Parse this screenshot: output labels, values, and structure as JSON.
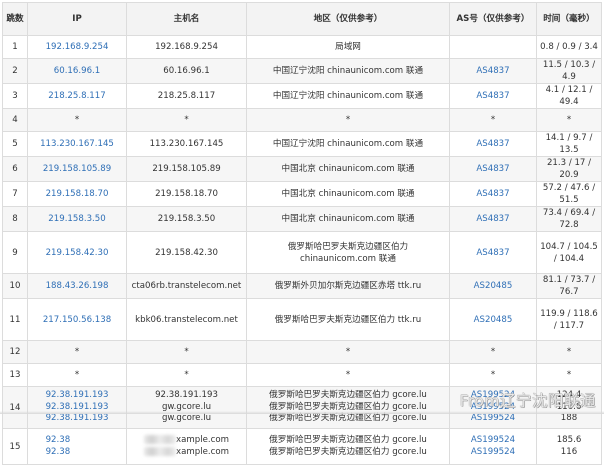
{
  "table": {
    "headers": {
      "hop": "跳数",
      "ip": "IP",
      "host": "主机名",
      "location": "地区（仅供参考）",
      "as": "AS号（仅供参考）",
      "time": "时间（毫秒）"
    },
    "rows": [
      {
        "hop": "1",
        "ip": "192.168.9.254",
        "host": "192.168.9.254",
        "loc": "局域网",
        "as": "",
        "time": "0.8 / 0.9 / 3.4"
      },
      {
        "hop": "2",
        "ip": "60.16.96.1",
        "host": "60.16.96.1",
        "loc": "中国辽宁沈阳 chinaunicom.com 联通",
        "as": "AS4837",
        "time": "11.5 / 10.3 / 4.9"
      },
      {
        "hop": "3",
        "ip": "218.25.8.117",
        "host": "218.25.8.117",
        "loc": "中国辽宁沈阳 chinaunicom.com 联通",
        "as": "AS4837",
        "time": "4.1 / 12.1 / 49.4"
      },
      {
        "hop": "4",
        "ip": "*",
        "host": "*",
        "loc": "*",
        "as": "*",
        "time": "*"
      },
      {
        "hop": "5",
        "ip": "113.230.167.145",
        "host": "113.230.167.145",
        "loc": "中国辽宁沈阳 chinaunicom.com 联通",
        "as": "AS4837",
        "time": "14.1 / 9.7 / 13.5"
      },
      {
        "hop": "6",
        "ip": "219.158.105.89",
        "host": "219.158.105.89",
        "loc": "中国北京 chinaunicom.com 联通",
        "as": "AS4837",
        "time": "21.3 / 17 / 20.9"
      },
      {
        "hop": "7",
        "ip": "219.158.18.70",
        "host": "219.158.18.70",
        "loc": "中国北京 chinaunicom.com 联通",
        "as": "AS4837",
        "time": "57.2 / 47.6 / 51.5"
      },
      {
        "hop": "8",
        "ip": "219.158.3.50",
        "host": "219.158.3.50",
        "loc": "中国北京 chinaunicom.com 联通",
        "as": "AS4837",
        "time": "73.4 / 69.4 / 72.8"
      },
      {
        "hop": "9",
        "ip": "219.158.42.30",
        "host": "219.158.42.30",
        "loc": "俄罗斯哈巴罗夫斯克边疆区伯力 chinaunicom.com 联通",
        "as": "AS4837",
        "time": "104.7 / 104.5 / 104.4"
      },
      {
        "hop": "10",
        "ip": "188.43.26.198",
        "host": "cta06rb.transtelecom.net",
        "loc": "俄罗斯外贝加尔斯克边疆区赤塔 ttk.ru",
        "as": "AS20485",
        "time": "81.1 / 73.7 / 76.7"
      },
      {
        "hop": "11",
        "ip": "217.150.56.138",
        "host": "kbk06.transtelecom.net",
        "loc": "俄罗斯哈巴罗夫斯克边疆区伯力 ttk.ru",
        "as": "AS20485",
        "time": "119.9 / 118.6 / 117.7"
      },
      {
        "hop": "12",
        "ip": "*",
        "host": "*",
        "loc": "*",
        "as": "*",
        "time": "*"
      },
      {
        "hop": "13",
        "ip": "*",
        "host": "*",
        "loc": "*",
        "as": "*",
        "time": "*"
      }
    ],
    "row14": {
      "hop": "14",
      "ips": [
        "92.38.191.193",
        "92.38.191.193",
        "92.38.191.193"
      ],
      "hosts": [
        "92.38.191.193",
        "gw.gcore.lu",
        "gw.gcore.lu"
      ],
      "locs": [
        "俄罗斯哈巴罗夫斯克边疆区伯力 gcore.lu",
        "俄罗斯哈巴罗夫斯克边疆区伯力 gcore.lu",
        "俄罗斯哈巴罗夫斯克边疆区伯力 gcore.lu"
      ],
      "as": [
        "AS199524",
        "AS199524",
        "AS199524"
      ],
      "times": [
        "124.4",
        "116.6",
        "188"
      ]
    },
    "row15": {
      "hop": "15",
      "ips": [
        "92.38",
        "92.38"
      ],
      "hosts": [
        "xample.com",
        "xample.com"
      ],
      "locs": [
        "俄罗斯哈巴罗夫斯克边疆区伯力 gcore.lu",
        "俄罗斯哈巴罗夫斯克边疆区伯力 gcore.lu"
      ],
      "as": [
        "AS199524",
        "AS199524"
      ],
      "times": [
        "185.6",
        "116"
      ]
    }
  },
  "watermark": "From辽宁沈阳联通",
  "colors": {
    "link": "#2f6fb6",
    "border": "#dcdcdc",
    "stripe": "#f6f6f6"
  }
}
